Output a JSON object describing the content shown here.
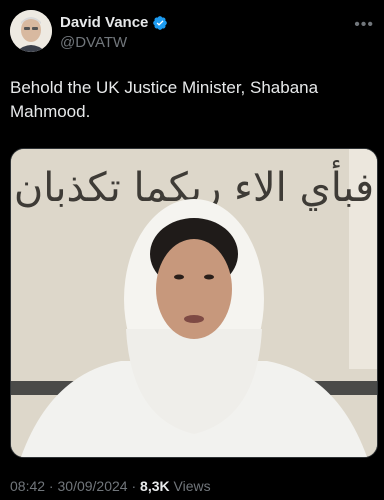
{
  "author": {
    "name": "David Vance",
    "handle": "@DVATW"
  },
  "tweet": {
    "text": "Behold the UK Justice Minister, Shabana Mahmood.",
    "overlay_script": "فبأي الاء ربكما تكذبان"
  },
  "meta": {
    "time": "08:42",
    "separator": " · ",
    "date": "30/09/2024",
    "views_count": "8,3K",
    "views_label": "Views"
  },
  "colors": {
    "background": "#000000",
    "text": "#e7e9ea",
    "secondary": "#71767b",
    "verified": "#1d9bf0"
  },
  "icons": {
    "verified": "verified-badge-icon",
    "more": "more-options-icon"
  }
}
